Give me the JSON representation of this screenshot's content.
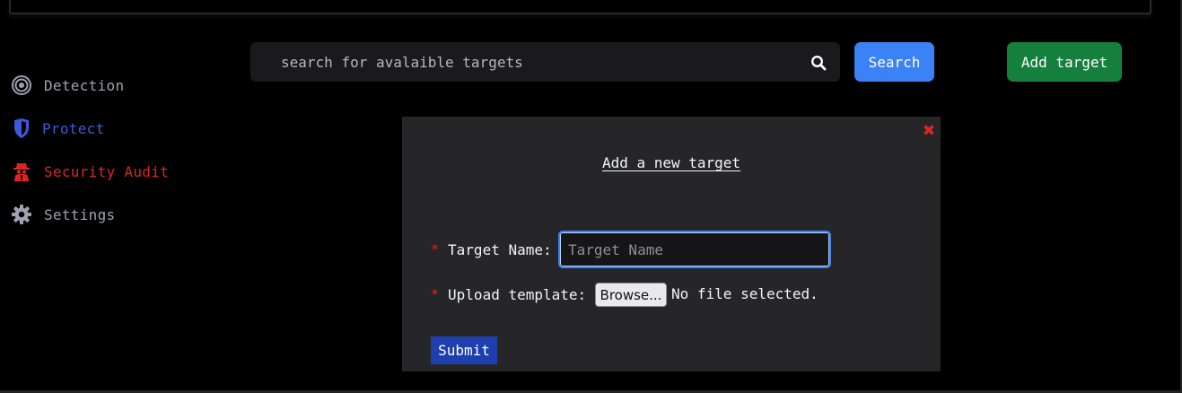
{
  "search": {
    "placeholder": "search for avalaible targets",
    "button_label": "Search",
    "icon": "search-icon"
  },
  "header": {
    "add_target_label": "Add target"
  },
  "sidebar": {
    "items": [
      {
        "label": "Detection",
        "icon": "target-icon",
        "color": "#9ca3af"
      },
      {
        "label": "Protect",
        "icon": "shield-icon",
        "color": "#3b5bdb"
      },
      {
        "label": "Security Audit",
        "icon": "spy-icon",
        "color": "#dc2626"
      },
      {
        "label": "Settings",
        "icon": "gear-icon",
        "color": "#9ca3af"
      }
    ]
  },
  "modal": {
    "title": "Add a new target",
    "close_icon": "close-icon",
    "fields": {
      "target_name_label": "Target Name:",
      "target_name_placeholder": "Target Name",
      "upload_label": "Upload template:",
      "browse_label": "Browse...",
      "file_status": "No file selected.",
      "required_marker": "*"
    },
    "submit_label": "Submit"
  },
  "colors": {
    "primary_blue": "#3b82f6",
    "success_green": "#15803d",
    "danger_red": "#dc2626",
    "submit_blue": "#1e40af"
  }
}
